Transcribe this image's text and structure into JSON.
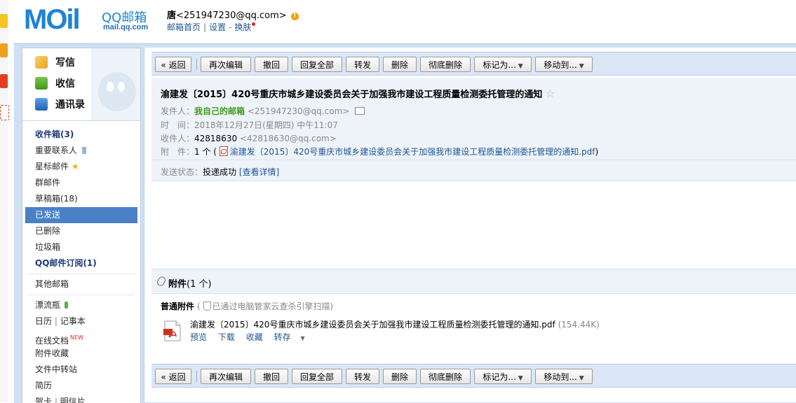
{
  "header": {
    "logo_text": "MOil",
    "brand": "QQ邮箱",
    "domain": "mail.qq.com",
    "user_name": "唐",
    "user_email": "<251947230@qq.com>",
    "links": [
      "邮箱首页",
      "设置",
      "换肤"
    ]
  },
  "sidebar": {
    "actions": [
      {
        "label": "写信",
        "icon": "compose-icon"
      },
      {
        "label": "收信",
        "icon": "inbox-download-icon"
      },
      {
        "label": "通讯录",
        "icon": "contacts-icon"
      }
    ],
    "folders": [
      {
        "label": "收件箱(3)"
      },
      {
        "label": "重要联系人"
      },
      {
        "label": "星标邮件"
      },
      {
        "label": "群邮件"
      },
      {
        "label": "草稿箱(18)"
      },
      {
        "label": "已发送"
      },
      {
        "label": "已删除"
      },
      {
        "label": "垃圾箱"
      },
      {
        "label": "QQ邮件订阅(1)"
      },
      {
        "label": "其他邮箱"
      },
      {
        "label": "漂流瓶"
      },
      {
        "label": "日历"
      },
      {
        "label": "记事本"
      },
      {
        "label": "在线文档"
      },
      {
        "label": "NEW"
      },
      {
        "label": "附件收藏"
      },
      {
        "label": "文件中转站"
      },
      {
        "label": "简历"
      },
      {
        "label": "贺卡"
      },
      {
        "label": "明信片"
      }
    ]
  },
  "toolbar": {
    "back": "« 返回",
    "reedit": "再次编辑",
    "recall": "撤回",
    "reply_all": "回复全部",
    "forward": "转发",
    "delete": "删除",
    "delete_forever": "彻底删除",
    "mark_as": "标记为...",
    "move_to": "移动到..."
  },
  "mail": {
    "subject": "渝建发〔2015〕420号重庆市城乡建设委员会关于加强我市建设工程质量检测委托管理的通知",
    "sender_label": "发件人：",
    "sender_name": "我自己的邮箱",
    "sender_email": "<251947230@qq.com>",
    "time_label": "时　间：",
    "time_value": "2018年12月27日(星期四) 中午11:07",
    "to_label": "收件人：",
    "to_name": "42818630",
    "to_email": "<42818630@qq.com>",
    "att_label": "附　件：",
    "att_count": "1 个 (",
    "att_file": "渝建发〔2015〕420号重庆市城乡建设委员会关于加强我市建设工程质量检测委托管理的通知.pdf",
    "att_close": ")",
    "status_label": "发送状态：",
    "status_value": "投递成功",
    "status_link": "[查看详情]"
  },
  "attachments": {
    "title": "附件",
    "count": "(1 个)",
    "section": "普通附件",
    "scan_note": "已通过电脑管家云查杀引擎扫描",
    "file_name": "渝建发〔2015〕420号重庆市城乡建设委员会关于加强我市建设工程质量检测委托管理的通知.pdf",
    "file_size": "(154.44K)",
    "ops": [
      "预览",
      "下载",
      "收藏",
      "转存"
    ]
  },
  "colors": {
    "brand_blue": "#1e84d4",
    "frame": "#cfe0f3",
    "selected": "#4a80c6",
    "sender_green": "#3f9a1f"
  }
}
